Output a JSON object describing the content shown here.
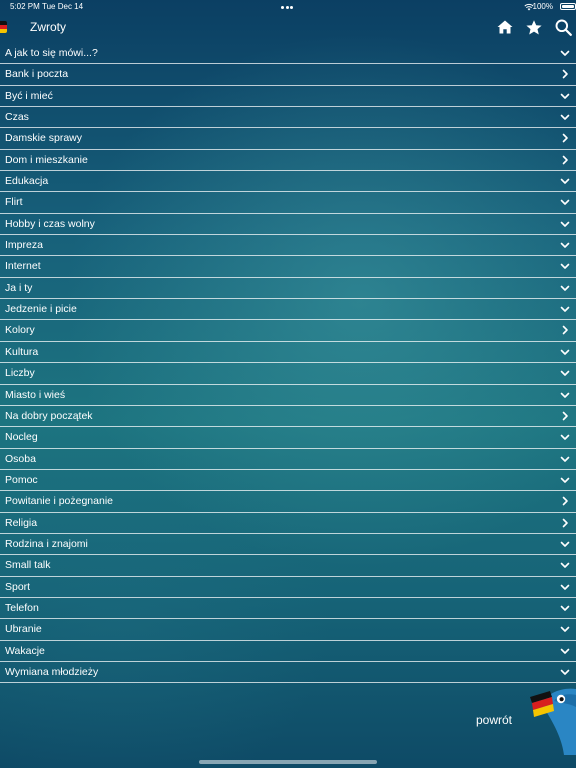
{
  "status_bar": {
    "time": "5:02 PM",
    "date": "Tue Dec 14",
    "battery": "100%"
  },
  "nav": {
    "title": "Zwroty",
    "icons": [
      "flag-germany-icon",
      "home-icon",
      "star-icon",
      "search-icon"
    ]
  },
  "categories": [
    {
      "label": "A jak to się mówi...?",
      "indicator": "chevron-down"
    },
    {
      "label": "Bank i poczta",
      "indicator": "chevron-right"
    },
    {
      "label": "Być i mieć",
      "indicator": "chevron-down"
    },
    {
      "label": "Czas",
      "indicator": "chevron-down"
    },
    {
      "label": "Damskie sprawy",
      "indicator": "chevron-right"
    },
    {
      "label": "Dom i mieszkanie",
      "indicator": "chevron-right"
    },
    {
      "label": "Edukacja",
      "indicator": "chevron-down"
    },
    {
      "label": "Flirt",
      "indicator": "chevron-down"
    },
    {
      "label": "Hobby i czas wolny",
      "indicator": "chevron-down"
    },
    {
      "label": "Impreza",
      "indicator": "chevron-down"
    },
    {
      "label": "Internet",
      "indicator": "chevron-down"
    },
    {
      "label": "Ja i ty",
      "indicator": "chevron-down"
    },
    {
      "label": "Jedzenie i picie",
      "indicator": "chevron-down"
    },
    {
      "label": "Kolory",
      "indicator": "chevron-right"
    },
    {
      "label": "Kultura",
      "indicator": "chevron-down"
    },
    {
      "label": "Liczby",
      "indicator": "chevron-down"
    },
    {
      "label": "Miasto i wieś",
      "indicator": "chevron-down"
    },
    {
      "label": "Na dobry początek",
      "indicator": "chevron-right"
    },
    {
      "label": "Nocleg",
      "indicator": "chevron-down"
    },
    {
      "label": "Osoba",
      "indicator": "chevron-down"
    },
    {
      "label": "Pomoc",
      "indicator": "chevron-down"
    },
    {
      "label": "Powitanie i pożegnanie",
      "indicator": "chevron-right"
    },
    {
      "label": "Religia",
      "indicator": "chevron-right"
    },
    {
      "label": "Rodzina i znajomi",
      "indicator": "chevron-down"
    },
    {
      "label": "Small talk",
      "indicator": "chevron-down"
    },
    {
      "label": "Sport",
      "indicator": "chevron-down"
    },
    {
      "label": "Telefon",
      "indicator": "chevron-down"
    },
    {
      "label": "Ubranie",
      "indicator": "chevron-down"
    },
    {
      "label": "Wakacje",
      "indicator": "chevron-down"
    },
    {
      "label": "Wymiana młodzieży",
      "indicator": "chevron-down"
    }
  ],
  "footer": {
    "back_label": "powrót",
    "mascot_icon": "mascot-bird-flag-icon"
  }
}
